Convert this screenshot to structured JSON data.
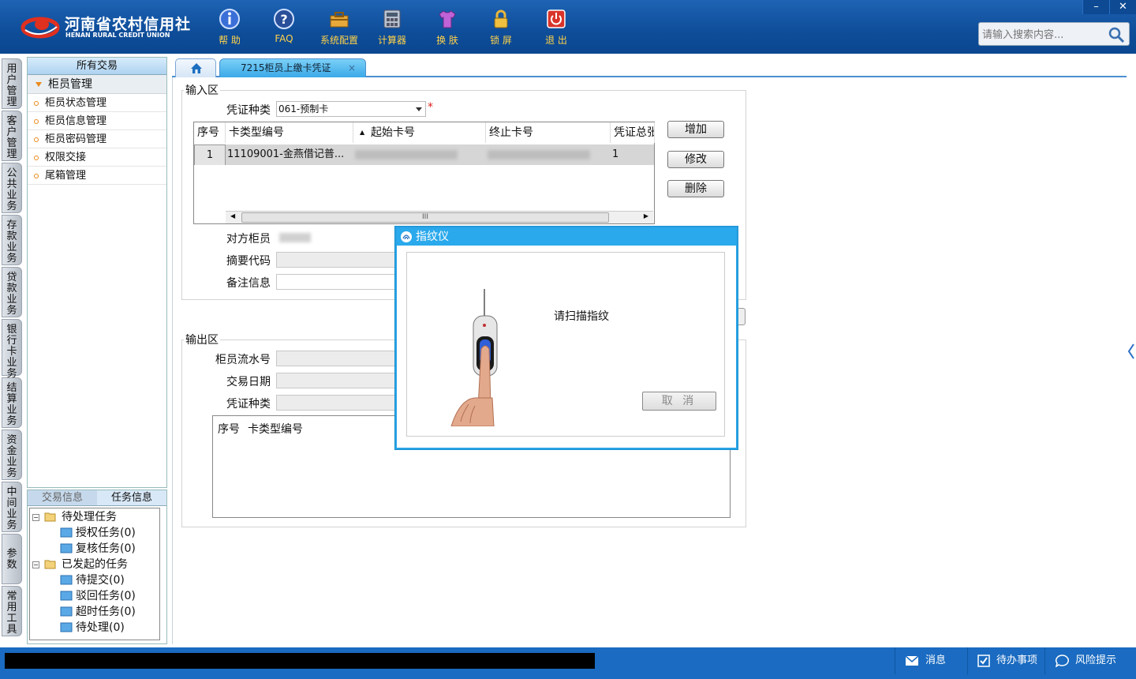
{
  "header": {
    "logo_cn": "河南省农村信用社",
    "logo_en": "HENAN RURAL CREDIT UNION",
    "tools": [
      {
        "label": "帮 助",
        "icon": "info-icon"
      },
      {
        "label": "FAQ",
        "icon": "question-icon"
      },
      {
        "label": "系统配置",
        "icon": "toolbox-icon"
      },
      {
        "label": "计算器",
        "icon": "calculator-icon"
      },
      {
        "label": "换 肤",
        "icon": "shirt-icon"
      },
      {
        "label": "锁 屏",
        "icon": "lock-icon"
      },
      {
        "label": "退 出",
        "icon": "power-icon"
      }
    ],
    "window": {
      "minimize": "–",
      "close": "✕"
    },
    "search_placeholder": "请输入搜索内容..."
  },
  "vertical_tabs": [
    "用户管理",
    "客户管理",
    "公共业务",
    "存款业务",
    "贷款业务",
    "银行卡业务",
    "结算业务",
    "资金业务",
    "中间业务",
    "参数",
    "常用工具"
  ],
  "nav": {
    "header": "所有交易",
    "group": "柜员管理",
    "items": [
      "柜员状态管理",
      "柜员信息管理",
      "柜员密码管理",
      "权限交接",
      "尾箱管理"
    ]
  },
  "tasks": {
    "tabs": [
      "交易信息",
      "任务信息"
    ],
    "tree": [
      {
        "label": "待处理任务",
        "children": [
          "授权任务(0)",
          "复核任务(0)"
        ]
      },
      {
        "label": "已发起的任务",
        "children": [
          "待提交(0)",
          "驳回任务(0)",
          "超时任务(0)",
          "待处理(0)"
        ]
      }
    ]
  },
  "tabs": {
    "active": "7215柜员上缴卡凭证",
    "close": "×"
  },
  "input_area": {
    "title": "输入区",
    "voucher_type_label": "凭证种类",
    "voucher_type_value": "061-预制卡",
    "required_mark": "*",
    "grid": {
      "columns": [
        "序号",
        "卡类型编号",
        "起始卡号",
        "终止卡号",
        "凭证总张"
      ],
      "rows": [
        {
          "seq": "1",
          "card_type": "11109001-金燕借记普...",
          "start": "",
          "end": "",
          "total": "1"
        }
      ],
      "scroll_thumb": "III"
    },
    "buttons": {
      "add": "增加",
      "edit": "修改",
      "delete": "删除"
    },
    "fields": [
      {
        "label": "对方柜员",
        "value": ""
      },
      {
        "label": "摘要代码",
        "value": ""
      },
      {
        "label": "备注信息",
        "value": ""
      }
    ]
  },
  "output_area": {
    "title": "输出区",
    "fields": [
      {
        "label": "柜员流水号",
        "value": ""
      },
      {
        "label": "交易日期",
        "value": ""
      },
      {
        "label": "凭证种类",
        "value": ""
      }
    ],
    "grid_columns": [
      "序号",
      "卡类型编号"
    ]
  },
  "dialog": {
    "title": "指纹仪",
    "message": "请扫描指纹",
    "cancel": "取 消"
  },
  "statusbar": {
    "items": [
      {
        "label": "消息",
        "icon": "mail-icon"
      },
      {
        "label": "待办事项",
        "icon": "checkbox-icon"
      },
      {
        "label": "风险提示",
        "icon": "chat-icon"
      }
    ]
  },
  "colors": {
    "header_blue": "#0e4d99",
    "accent_blue": "#2aa9ec",
    "tool_label": "#ffd24a",
    "required": "#e02020"
  }
}
